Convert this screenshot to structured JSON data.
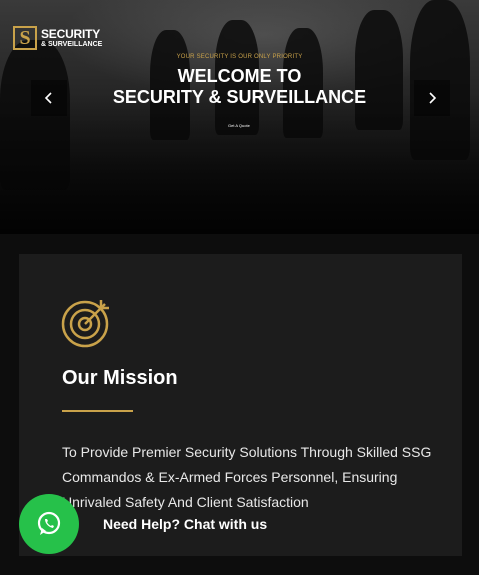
{
  "logo": {
    "mark": "S",
    "line1": "SECURITY",
    "line2": "& SURVEILLANCE"
  },
  "hero": {
    "tagline": "YOUR SECURITY IS OUR ONLY PRIORITY",
    "title_line1": "WELCOME TO",
    "title_line2": "SECURITY & SURVEILLANCE",
    "cta": "Get A Quote",
    "prev_icon": "chevron-left-icon",
    "next_icon": "chevron-right-icon"
  },
  "mission": {
    "icon": "target-icon",
    "title": "Our Mission",
    "text": "To Provide Premier Security Solutions Through Skilled SSG Commandos & Ex-Armed Forces Personnel, Ensuring Unrivaled Safety And Client Satisfaction"
  },
  "chat": {
    "icon": "whatsapp-icon",
    "label": "Need Help? Chat with us"
  },
  "colors": {
    "accent": "#c9a24a",
    "card_bg": "#1c1c1c",
    "page_bg": "#0d0d0d",
    "whatsapp": "#26c14a"
  }
}
